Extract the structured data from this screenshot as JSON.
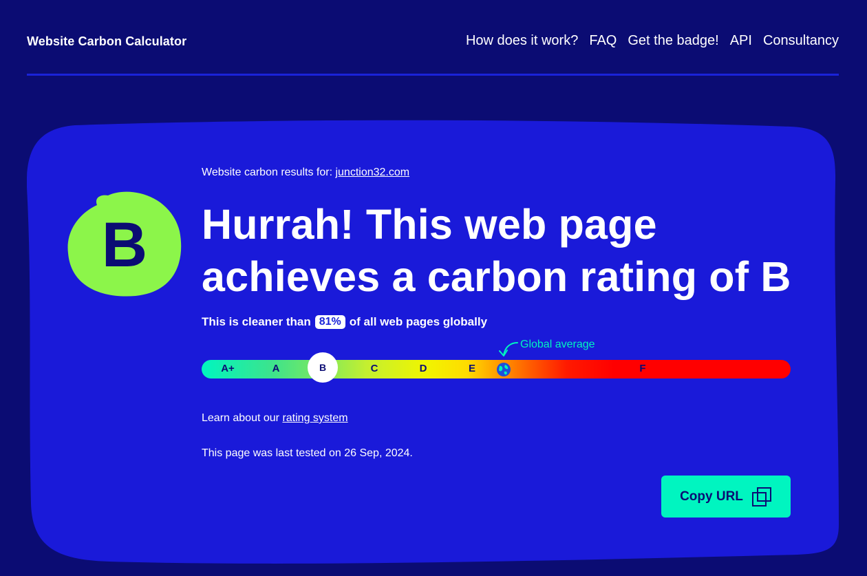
{
  "header": {
    "logo": "Website Carbon Calculator",
    "nav": [
      "How does it work?",
      "FAQ",
      "Get the badge!",
      "API",
      "Consultancy"
    ]
  },
  "result": {
    "grade": "B",
    "results_for_prefix": "Website carbon results for:",
    "site": "junction32.com",
    "headline": "Hurrah! This web page achieves a carbon rating of B",
    "cleaner_prefix": "This is cleaner than",
    "cleaner_percent": "81%",
    "cleaner_suffix": "of all web pages globally",
    "global_average_label": "Global average",
    "learn_prefix": "Learn about our",
    "learn_link": "rating system",
    "tested": "This page was last tested on 26 Sep, 2024.",
    "copy_button": "Copy URL"
  },
  "rating_bar": {
    "labels": [
      "A+",
      "A",
      "B",
      "C",
      "D",
      "E",
      "F"
    ],
    "selected": "B"
  },
  "colors": {
    "background": "#0b0c73",
    "card": "#1a1ad9",
    "grade_blob": "#8cf54a",
    "accent": "#00f5c0"
  },
  "icons": [
    "arrow-icon",
    "globe-icon",
    "copy-icon"
  ]
}
